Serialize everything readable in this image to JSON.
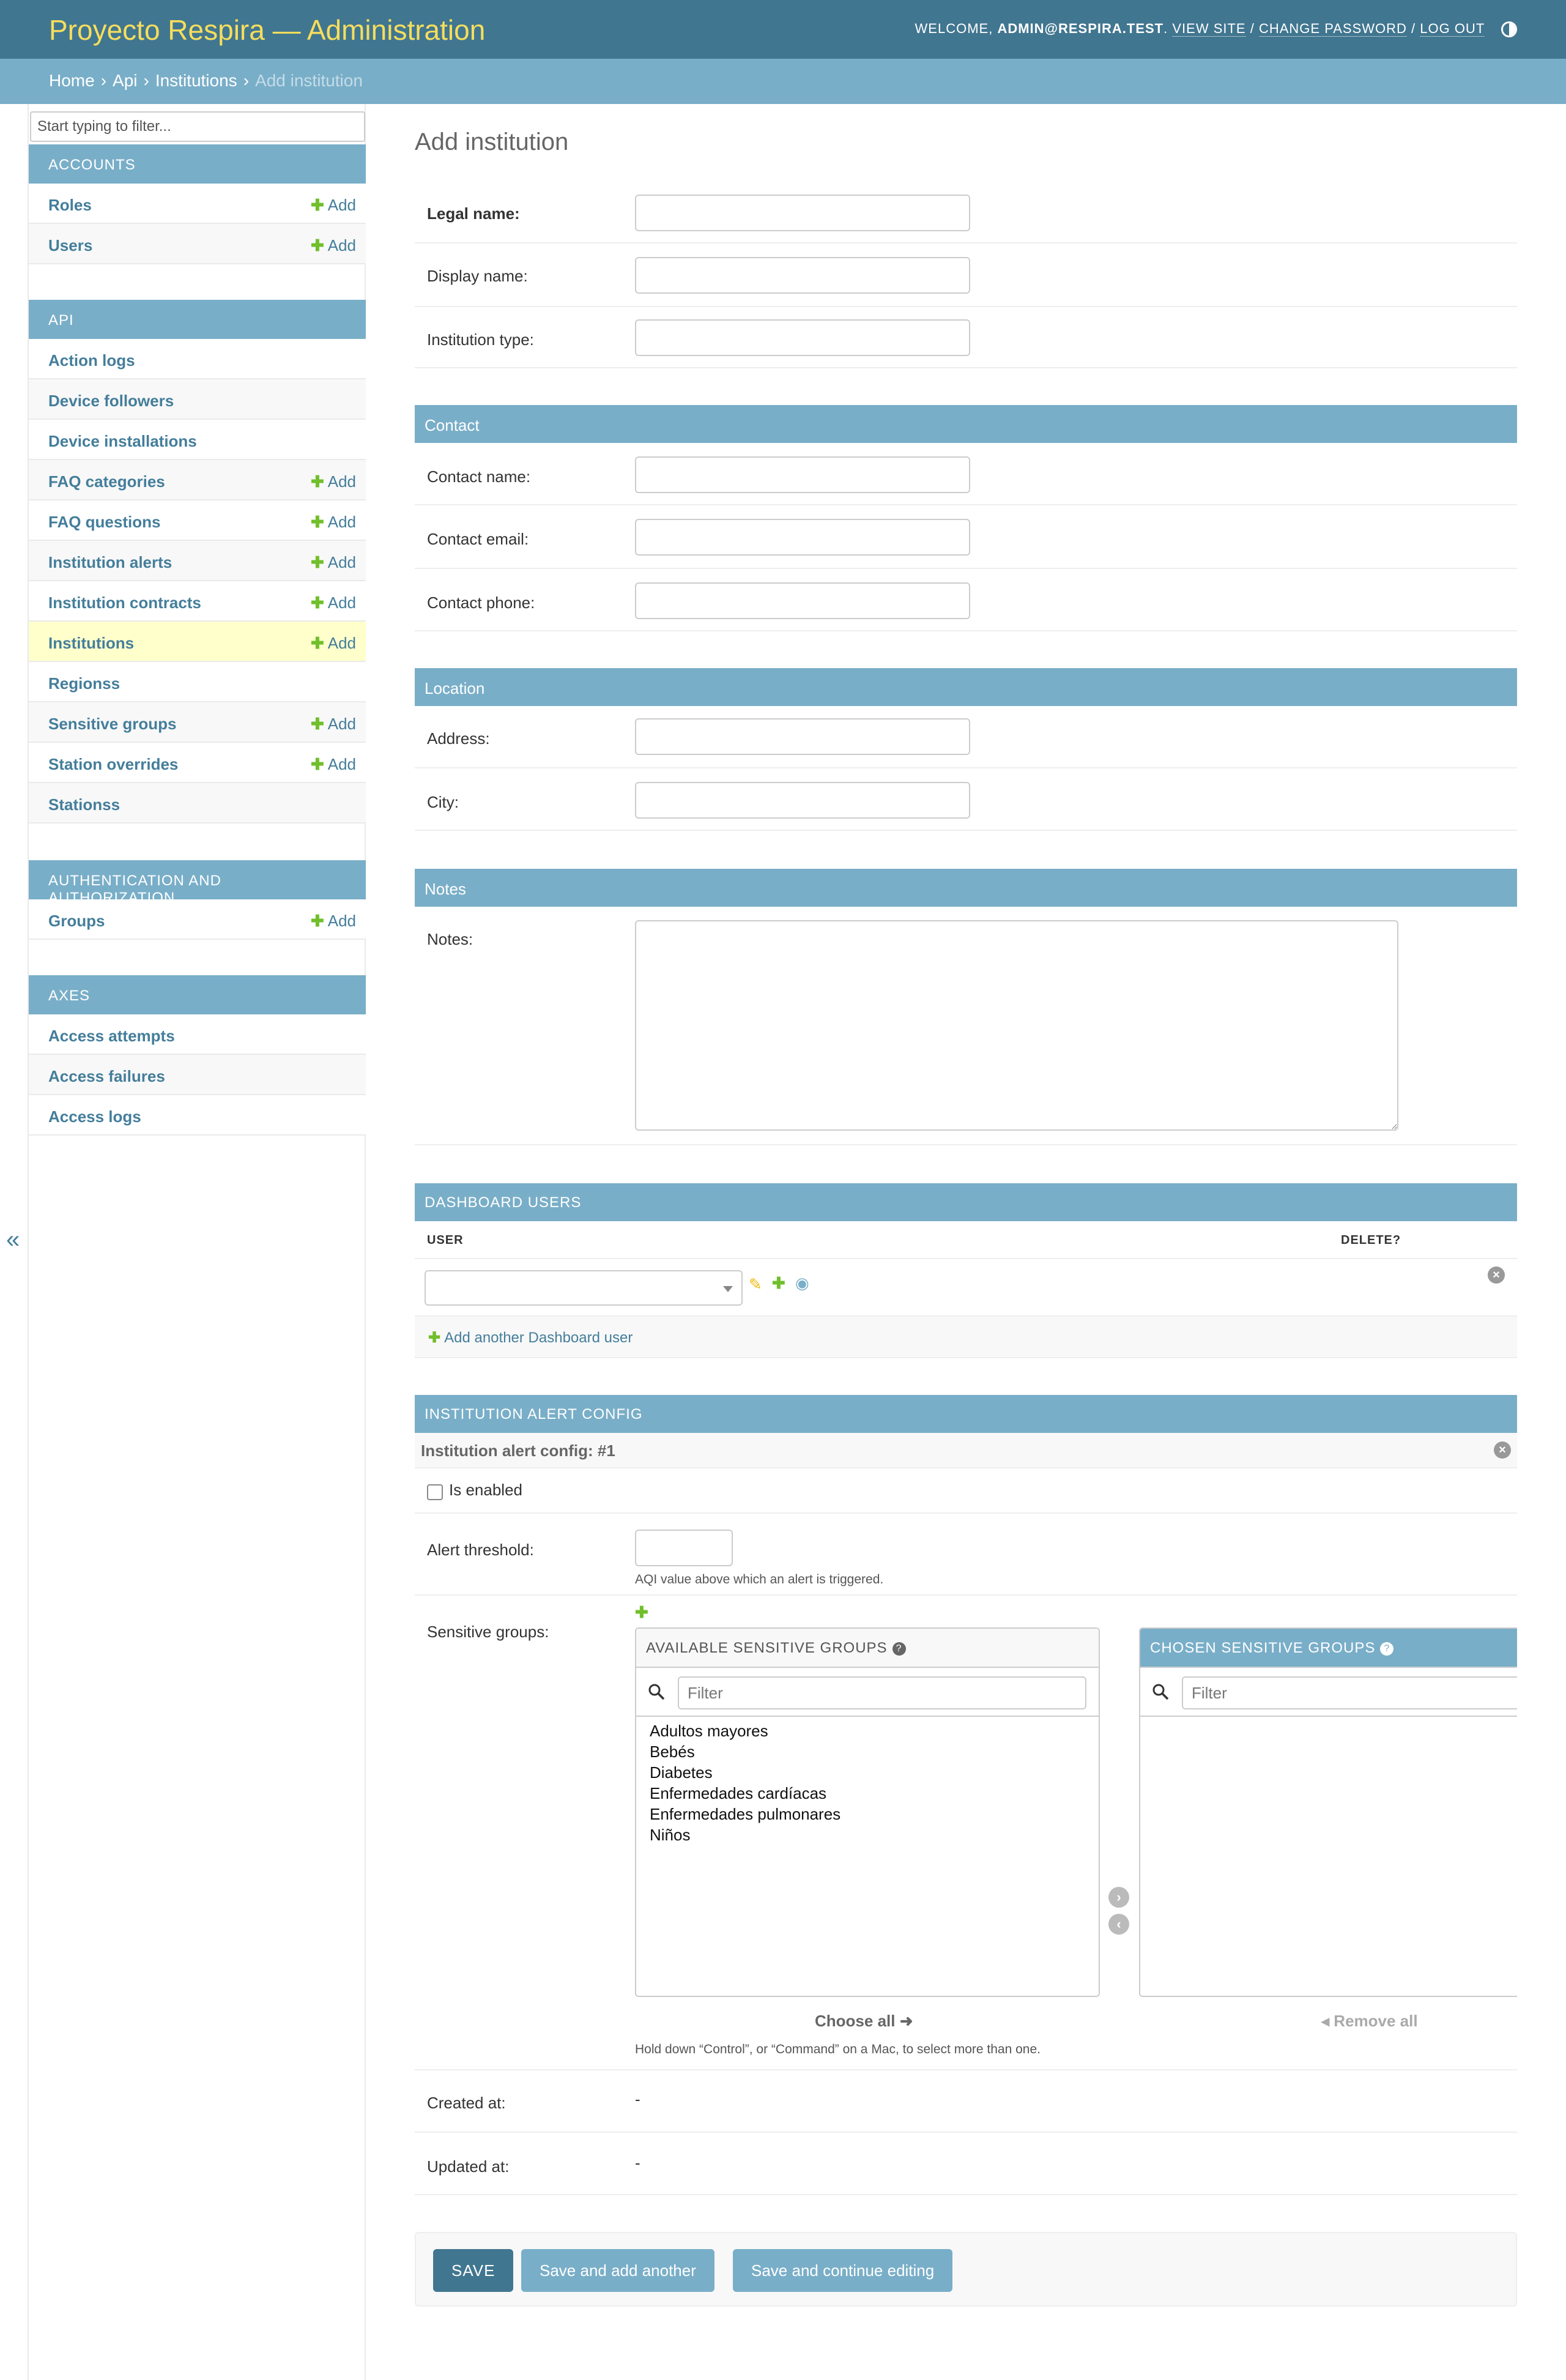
{
  "header": {
    "branding": "Proyecto Respira — Administration",
    "welcome": "WELCOME,",
    "user": "ADMIN@RESPIRA.TEST",
    "view_site": "VIEW SITE",
    "change_password": "CHANGE PASSWORD",
    "log_out": "LOG OUT"
  },
  "breadcrumbs": {
    "home": "Home",
    "api": "Api",
    "institutions": "Institutions",
    "current": "Add institution"
  },
  "sidebar": {
    "filter_placeholder": "Start typing to filter...",
    "add_label": "Add",
    "modules": [
      {
        "caption": "ACCOUNTS",
        "models": [
          {
            "name": "Roles",
            "add": true
          },
          {
            "name": "Users",
            "add": true
          }
        ]
      },
      {
        "caption": "API",
        "models": [
          {
            "name": "Action logs",
            "add": false
          },
          {
            "name": "Device followers",
            "add": false
          },
          {
            "name": "Device installations",
            "add": false
          },
          {
            "name": "FAQ categories",
            "add": true
          },
          {
            "name": "FAQ questions",
            "add": true
          },
          {
            "name": "Institution alerts",
            "add": true
          },
          {
            "name": "Institution contracts",
            "add": true
          },
          {
            "name": "Institutions",
            "add": true,
            "selected": true
          },
          {
            "name": "Regionss",
            "add": false
          },
          {
            "name": "Sensitive groups",
            "add": true
          },
          {
            "name": "Station overrides",
            "add": true
          },
          {
            "name": "Stationss",
            "add": false
          }
        ]
      },
      {
        "caption": "AUTHENTICATION AND AUTHORIZATION",
        "models": [
          {
            "name": "Groups",
            "add": true
          }
        ]
      },
      {
        "caption": "AXES",
        "models": [
          {
            "name": "Access attempts",
            "add": false
          },
          {
            "name": "Access failures",
            "add": false
          },
          {
            "name": "Access logs",
            "add": false
          }
        ]
      }
    ],
    "collapse_glyph": "«"
  },
  "page": {
    "title": "Add institution"
  },
  "form": {
    "legal_name_label": "Legal name:",
    "display_name_label": "Display name:",
    "institution_type_label": "Institution type:",
    "contact_caption": "Contact",
    "contact_name_label": "Contact name:",
    "contact_email_label": "Contact email:",
    "contact_phone_label": "Contact phone:",
    "location_caption": "Location",
    "address_label": "Address:",
    "city_label": "City:",
    "notes_caption": "Notes",
    "notes_label": "Notes:"
  },
  "dashboard_users": {
    "caption": "DASHBOARD USERS",
    "col_user": "USER",
    "col_delete": "DELETE?",
    "add_another": "Add another Dashboard user"
  },
  "alert_config": {
    "caption": "INSTITUTION ALERT CONFIG",
    "inline_title": "Institution alert config: #1",
    "is_enabled_label": "Is enabled",
    "alert_threshold_label": "Alert threshold:",
    "alert_threshold_help": "AQI value above which an alert is triggered.",
    "sensitive_groups_label": "Sensitive groups:",
    "available_title": "AVAILABLE SENSITIVE GROUPS",
    "chosen_title": "CHOSEN SENSITIVE GROUPS",
    "filter_placeholder": "Filter",
    "available_options": [
      "Adultos mayores",
      "Bebés",
      "Diabetes",
      "Enfermedades cardíacas",
      "Enfermedades pulmonares",
      "Niños"
    ],
    "choose_all": "Choose all",
    "remove_all": "Remove all",
    "select_help": "Hold down “Control”, or “Command” on a Mac, to select more than one.",
    "created_at_label": "Created at:",
    "created_at_value": "-",
    "updated_at_label": "Updated at:",
    "updated_at_value": "-"
  },
  "submit": {
    "save": "SAVE",
    "save_add_another": "Save and add another",
    "save_continue": "Save and continue editing"
  },
  "colors": {
    "header_bg": "#417690",
    "breadcrumb_bg": "#79aec8",
    "branding": "#f5dd5d",
    "link": "#447e9b",
    "add_plus": "#70bf2b",
    "selected_row": "#ffffcc"
  }
}
